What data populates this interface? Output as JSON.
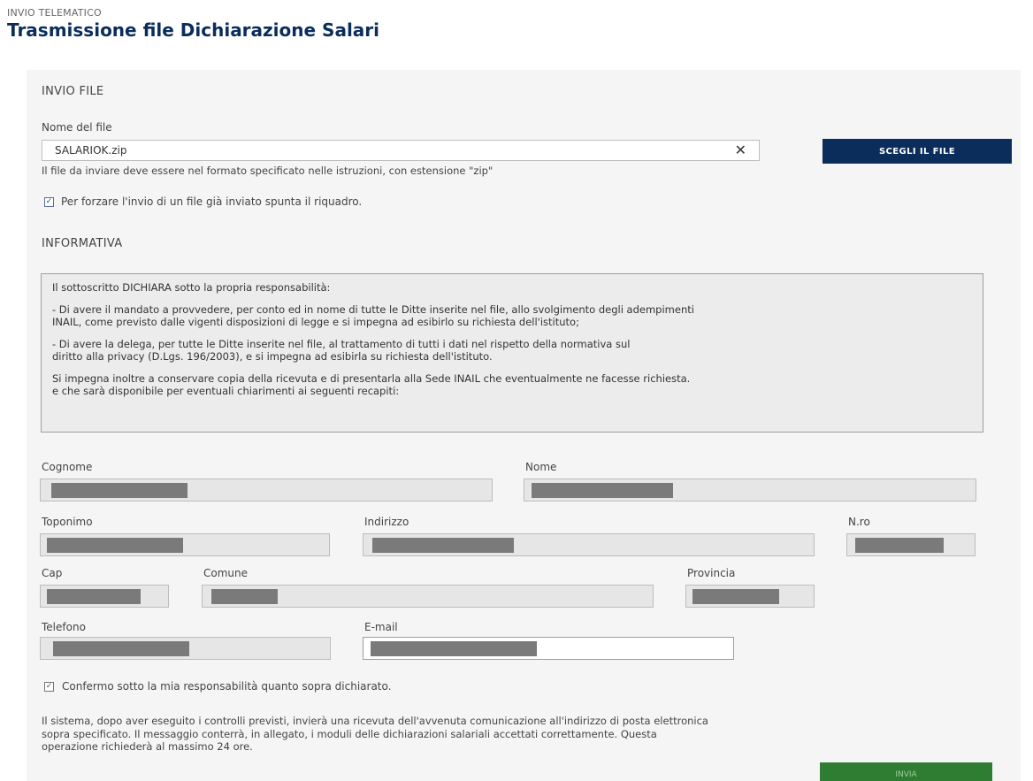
{
  "header": {
    "breadcrumb": "INVIO TELEMATICO",
    "title": "Trasmissione file Dichiarazione Salari"
  },
  "invio_file": {
    "section_title": "INVIO FILE",
    "file_label": "Nome del file",
    "file_value": "SALARIOK.zip",
    "clear_icon": "close-icon",
    "choose_button": "SCEGLI IL FILE",
    "format_hint": "Il file da inviare deve essere nel formato specificato nelle istruzioni, con estensione \"zip\"",
    "force_checkbox": {
      "checked": true,
      "label": "Per forzare l'invio di un file già inviato spunta il riquadro."
    }
  },
  "informativa": {
    "section_title": "INFORMATIVA",
    "paragraphs": [
      "Il sottoscritto DICHIARA sotto la propria responsabilità:",
      "- Di avere il mandato a provvedere, per conto ed in nome di tutte le Ditte inserite nel file, allo svolgimento degli adempimenti\nINAIL, come previsto dalle vigenti disposizioni di legge e si impegna ad esibirlo su richiesta dell'istituto;",
      "- Di avere la delega, per tutte le Ditte inserite nel file, al trattamento di tutti i dati nel rispetto della normativa sul\ndiritto alla privacy (D.Lgs. 196/2003), e si impegna ad esibirla su richiesta dell'istituto.",
      "Si impegna inoltre a conservare copia della ricevuta e di presentarla alla Sede INAIL che eventualmente ne facesse richiesta.\ne che sarà disponibile per eventuali chiarimenti ai seguenti recapiti:"
    ]
  },
  "form": {
    "cognome_label": "Cognome",
    "nome_label": "Nome",
    "toponimo_label": "Toponimo",
    "indirizzo_label": "Indirizzo",
    "nro_label": "N.ro",
    "cap_label": "Cap",
    "comune_label": "Comune",
    "provincia_label": "Provincia",
    "telefono_label": "Telefono",
    "email_label": "E-mail"
  },
  "confirm": {
    "checked": true,
    "label": "Confermo sotto la mia responsabilità quanto sopra dichiarato."
  },
  "footer_note": "Il sistema, dopo aver eseguito i controlli previsti, invierà una ricevuta dell'avvenuta comunicazione all'indirizzo di posta elettronica\nsopra specificato. Il messaggio conterrà, in allegato, i moduli delle dichiarazioni salariali accettati correttamente. Questa\noperazione richiederà al massimo 24 ore.",
  "submit_button": "INVIA",
  "colors": {
    "title": "#0b2d5b",
    "primary_button": "#0b2d5b",
    "submit_button": "#2e7d32"
  }
}
